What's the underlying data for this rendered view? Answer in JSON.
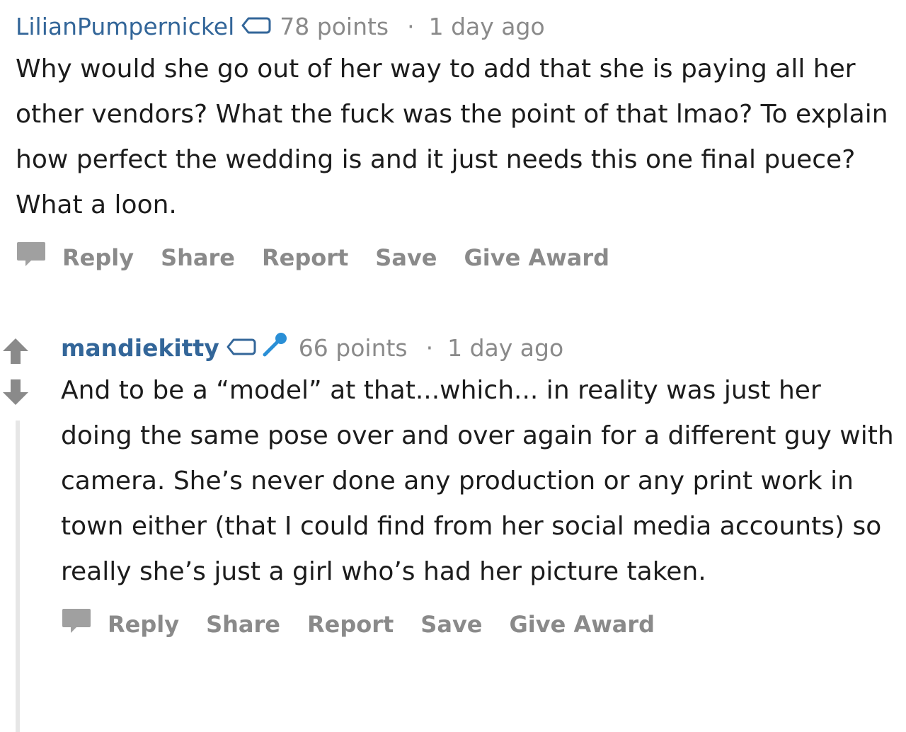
{
  "comments": [
    {
      "author": "LilianPumpernickel",
      "points": "78 points",
      "separator": "·",
      "time": "1 day ago",
      "body": "Why would she go out of her way to add that she is paying all her other vendors? What the fuck was the point of that lmao? To explain how perfect the wedding is and it just needs this one final puece? What a loon.",
      "actions": [
        "Reply",
        "Share",
        "Report",
        "Save",
        "Give Award"
      ],
      "icons": [
        "tag-flair-icon",
        "comment-bubble-icon"
      ]
    },
    {
      "author": "mandiekitty",
      "points": "66 points",
      "separator": "·",
      "time": "1 day ago",
      "body": "And to be a “model” at that...which... in reality was just her doing the same pose over and over again for a different guy with camera. She’s never done any production or any print work in town either (that I could find from her social media accounts) so really she’s just a girl who’s had her picture taken.",
      "actions": [
        "Reply",
        "Share",
        "Report",
        "Save",
        "Give Award"
      ],
      "icons": [
        "upvote-arrow-icon",
        "downvote-arrow-icon",
        "tag-flair-icon",
        "microphone-icon",
        "comment-bubble-icon"
      ]
    }
  ],
  "colors": {
    "author": "#336699",
    "muted": "#8a8a8a",
    "mic": "#2a8fd6",
    "thread_line": "#e6e6e6"
  }
}
